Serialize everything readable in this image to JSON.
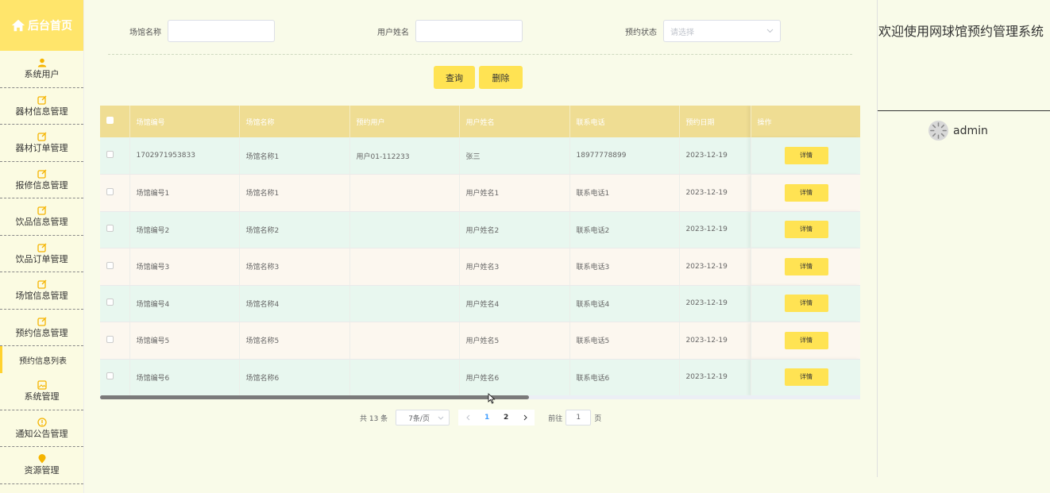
{
  "brand": {
    "title": "后台首页",
    "icon": "home-icon"
  },
  "sidebar": {
    "items": [
      {
        "label": "系统用户",
        "icon": "user-icon"
      },
      {
        "label": "器材信息管理",
        "icon": "edit-icon"
      },
      {
        "label": "器材订单管理",
        "icon": "edit-icon"
      },
      {
        "label": "报修信息管理",
        "icon": "edit-icon"
      },
      {
        "label": "饮品信息管理",
        "icon": "edit-icon"
      },
      {
        "label": "饮品订单管理",
        "icon": "edit-icon"
      },
      {
        "label": "场馆信息管理",
        "icon": "edit-icon"
      },
      {
        "label": "预约信息管理",
        "icon": "edit-icon"
      }
    ],
    "active_sub": "预约信息列表",
    "items_after": [
      {
        "label": "系统管理",
        "icon": "image-icon"
      },
      {
        "label": "通知公告管理",
        "icon": "info-icon"
      },
      {
        "label": "资源管理",
        "icon": "location-icon"
      }
    ]
  },
  "filters": {
    "venue_name_label": "场馆名称",
    "venue_name_value": "",
    "user_name_label": "用户姓名",
    "user_name_value": "",
    "status_label": "预约状态",
    "status_placeholder": "请选择"
  },
  "buttons": {
    "query": "查询",
    "delete": "删除"
  },
  "table": {
    "headers": [
      "场馆编号",
      "场馆名称",
      "预约用户",
      "用户姓名",
      "联系电话",
      "预约日期",
      "操作"
    ],
    "action_label": "详情",
    "rows": [
      [
        "1702971953833",
        "场馆名称1",
        "用户01-112233",
        "张三",
        "18977778899",
        "2023-12-19"
      ],
      [
        "场馆编号1",
        "场馆名称1",
        "",
        "用户姓名1",
        "联系电话1",
        "2023-12-19"
      ],
      [
        "场馆编号2",
        "场馆名称2",
        "",
        "用户姓名2",
        "联系电话2",
        "2023-12-19"
      ],
      [
        "场馆编号3",
        "场馆名称3",
        "",
        "用户姓名3",
        "联系电话3",
        "2023-12-19"
      ],
      [
        "场馆编号4",
        "场馆名称4",
        "",
        "用户姓名4",
        "联系电话4",
        "2023-12-19"
      ],
      [
        "场馆编号5",
        "场馆名称5",
        "",
        "用户姓名5",
        "联系电话5",
        "2023-12-19"
      ],
      [
        "场馆编号6",
        "场馆名称6",
        "",
        "用户姓名6",
        "联系电话6",
        "2023-12-19"
      ]
    ]
  },
  "pagination": {
    "total_text": "共 13 条",
    "page_size": "7条/页",
    "pages": [
      "1",
      "2"
    ],
    "current_page": "1",
    "goto_prefix": "前往",
    "goto_value": "1",
    "goto_suffix": "页"
  },
  "header_right": {
    "welcome": "欢迎使用网球馆预约管理系统",
    "username": "admin"
  },
  "colors": {
    "accent": "#ffe353",
    "brand_bg": "#ffe56b",
    "table_header": "#efdd93",
    "row_even": "#e8f7ef",
    "row_odd": "#fcf7ef"
  }
}
